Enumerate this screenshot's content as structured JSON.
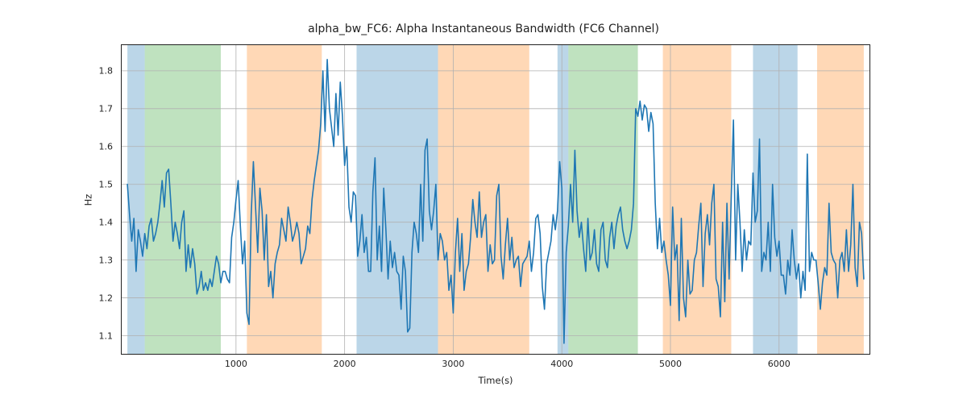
{
  "chart_data": {
    "type": "line",
    "title": "alpha_bw_FC6: Alpha Instantaneous Bandwidth (FC6 Channel)",
    "xlabel": "Time(s)",
    "ylabel": "Hz",
    "xlim": [
      -60,
      6840
    ],
    "ylim": [
      1.05,
      1.87
    ],
    "xticks": [
      1000,
      2000,
      3000,
      4000,
      5000,
      6000
    ],
    "yticks": [
      1.1,
      1.2,
      1.3,
      1.4,
      1.5,
      1.6,
      1.7,
      1.8
    ],
    "regions": [
      {
        "x0": 0,
        "x1": 160,
        "color": "#1f77b4"
      },
      {
        "x0": 160,
        "x1": 860,
        "color": "#2ca02c"
      },
      {
        "x0": 1100,
        "x1": 1790,
        "color": "#ff7f0e"
      },
      {
        "x0": 2110,
        "x1": 2860,
        "color": "#1f77b4"
      },
      {
        "x0": 2860,
        "x1": 3700,
        "color": "#ff7f0e"
      },
      {
        "x0": 3960,
        "x1": 4060,
        "color": "#1f77b4"
      },
      {
        "x0": 4060,
        "x1": 4700,
        "color": "#2ca02c"
      },
      {
        "x0": 4930,
        "x1": 5560,
        "color": "#ff7f0e"
      },
      {
        "x0": 5760,
        "x1": 6170,
        "color": "#1f77b4"
      },
      {
        "x0": 6350,
        "x1": 6780,
        "color": "#ff7f0e"
      }
    ],
    "series": [
      {
        "name": "alpha_bw_FC6",
        "color": "#1f77b4",
        "x": [
          0,
          20,
          40,
          60,
          80,
          100,
          120,
          140,
          160,
          180,
          200,
          220,
          240,
          260,
          280,
          300,
          320,
          340,
          360,
          380,
          400,
          420,
          440,
          460,
          480,
          500,
          520,
          540,
          560,
          580,
          600,
          620,
          640,
          660,
          680,
          700,
          720,
          740,
          760,
          780,
          800,
          820,
          840,
          860,
          880,
          900,
          920,
          940,
          960,
          980,
          1000,
          1020,
          1040,
          1060,
          1080,
          1100,
          1120,
          1140,
          1160,
          1180,
          1200,
          1220,
          1240,
          1260,
          1280,
          1300,
          1320,
          1340,
          1360,
          1380,
          1400,
          1420,
          1440,
          1460,
          1480,
          1500,
          1520,
          1540,
          1560,
          1580,
          1600,
          1620,
          1640,
          1660,
          1680,
          1700,
          1720,
          1740,
          1760,
          1780,
          1800,
          1820,
          1840,
          1860,
          1880,
          1900,
          1920,
          1940,
          1960,
          1980,
          2000,
          2020,
          2040,
          2060,
          2080,
          2100,
          2120,
          2140,
          2160,
          2180,
          2200,
          2220,
          2240,
          2260,
          2280,
          2300,
          2320,
          2340,
          2360,
          2380,
          2400,
          2420,
          2440,
          2460,
          2480,
          2500,
          2520,
          2540,
          2560,
          2580,
          2600,
          2620,
          2640,
          2660,
          2680,
          2700,
          2720,
          2740,
          2760,
          2780,
          2800,
          2820,
          2840,
          2860,
          2880,
          2900,
          2920,
          2940,
          2960,
          2980,
          3000,
          3020,
          3040,
          3060,
          3080,
          3100,
          3120,
          3140,
          3160,
          3180,
          3200,
          3220,
          3240,
          3260,
          3280,
          3300,
          3320,
          3340,
          3360,
          3380,
          3400,
          3420,
          3440,
          3460,
          3480,
          3500,
          3520,
          3540,
          3560,
          3580,
          3600,
          3620,
          3640,
          3660,
          3680,
          3700,
          3720,
          3740,
          3760,
          3780,
          3800,
          3820,
          3840,
          3860,
          3880,
          3900,
          3920,
          3940,
          3960,
          3980,
          4000,
          4020,
          4040,
          4060,
          4080,
          4100,
          4120,
          4140,
          4160,
          4180,
          4200,
          4220,
          4240,
          4260,
          4280,
          4300,
          4320,
          4340,
          4360,
          4380,
          4400,
          4420,
          4440,
          4460,
          4480,
          4500,
          4520,
          4540,
          4560,
          4580,
          4600,
          4620,
          4640,
          4660,
          4680,
          4700,
          4720,
          4740,
          4760,
          4780,
          4800,
          4820,
          4840,
          4860,
          4880,
          4900,
          4920,
          4940,
          4960,
          4980,
          5000,
          5020,
          5040,
          5060,
          5080,
          5100,
          5120,
          5140,
          5160,
          5180,
          5200,
          5220,
          5240,
          5260,
          5280,
          5300,
          5320,
          5340,
          5360,
          5380,
          5400,
          5420,
          5440,
          5460,
          5480,
          5500,
          5520,
          5540,
          5560,
          5580,
          5600,
          5620,
          5640,
          5660,
          5680,
          5700,
          5720,
          5740,
          5760,
          5780,
          5800,
          5820,
          5840,
          5860,
          5880,
          5900,
          5920,
          5940,
          5960,
          5980,
          6000,
          6020,
          6040,
          6060,
          6080,
          6100,
          6120,
          6140,
          6160,
          6180,
          6200,
          6220,
          6240,
          6260,
          6280,
          6300,
          6320,
          6340,
          6360,
          6380,
          6400,
          6420,
          6440,
          6460,
          6480,
          6500,
          6520,
          6540,
          6560,
          6580,
          6600,
          6620,
          6640,
          6660,
          6680,
          6700,
          6720,
          6740,
          6760,
          6780
        ],
        "values": [
          1.5,
          1.42,
          1.35,
          1.41,
          1.27,
          1.38,
          1.35,
          1.31,
          1.37,
          1.33,
          1.39,
          1.41,
          1.35,
          1.37,
          1.4,
          1.45,
          1.51,
          1.44,
          1.53,
          1.54,
          1.45,
          1.35,
          1.4,
          1.37,
          1.33,
          1.4,
          1.43,
          1.27,
          1.34,
          1.28,
          1.33,
          1.29,
          1.21,
          1.23,
          1.27,
          1.22,
          1.24,
          1.22,
          1.25,
          1.23,
          1.27,
          1.31,
          1.29,
          1.24,
          1.27,
          1.27,
          1.25,
          1.24,
          1.36,
          1.4,
          1.46,
          1.51,
          1.39,
          1.29,
          1.35,
          1.16,
          1.13,
          1.42,
          1.56,
          1.44,
          1.32,
          1.49,
          1.43,
          1.3,
          1.42,
          1.23,
          1.27,
          1.2,
          1.29,
          1.32,
          1.34,
          1.41,
          1.38,
          1.35,
          1.44,
          1.4,
          1.35,
          1.37,
          1.4,
          1.37,
          1.29,
          1.31,
          1.33,
          1.39,
          1.37,
          1.46,
          1.51,
          1.55,
          1.59,
          1.66,
          1.8,
          1.64,
          1.83,
          1.7,
          1.65,
          1.6,
          1.74,
          1.63,
          1.77,
          1.68,
          1.55,
          1.6,
          1.44,
          1.4,
          1.48,
          1.47,
          1.31,
          1.35,
          1.42,
          1.32,
          1.36,
          1.27,
          1.27,
          1.48,
          1.57,
          1.3,
          1.39,
          1.27,
          1.49,
          1.38,
          1.25,
          1.35,
          1.28,
          1.32,
          1.27,
          1.26,
          1.17,
          1.31,
          1.27,
          1.11,
          1.12,
          1.32,
          1.4,
          1.37,
          1.32,
          1.5,
          1.35,
          1.59,
          1.62,
          1.43,
          1.38,
          1.43,
          1.5,
          1.3,
          1.37,
          1.35,
          1.3,
          1.32,
          1.22,
          1.26,
          1.16,
          1.32,
          1.41,
          1.27,
          1.37,
          1.22,
          1.27,
          1.29,
          1.36,
          1.46,
          1.4,
          1.36,
          1.48,
          1.36,
          1.4,
          1.42,
          1.27,
          1.34,
          1.29,
          1.3,
          1.47,
          1.5,
          1.31,
          1.25,
          1.34,
          1.41,
          1.3,
          1.36,
          1.28,
          1.3,
          1.31,
          1.23,
          1.29,
          1.3,
          1.31,
          1.35,
          1.27,
          1.32,
          1.41,
          1.42,
          1.37,
          1.23,
          1.17,
          1.29,
          1.32,
          1.35,
          1.42,
          1.38,
          1.43,
          1.56,
          1.49,
          1.08,
          1.32,
          1.39,
          1.5,
          1.4,
          1.59,
          1.43,
          1.36,
          1.4,
          1.33,
          1.27,
          1.41,
          1.3,
          1.32,
          1.38,
          1.29,
          1.27,
          1.38,
          1.4,
          1.3,
          1.28,
          1.36,
          1.4,
          1.33,
          1.39,
          1.42,
          1.44,
          1.38,
          1.35,
          1.33,
          1.35,
          1.38,
          1.45,
          1.7,
          1.68,
          1.72,
          1.67,
          1.71,
          1.7,
          1.64,
          1.69,
          1.66,
          1.45,
          1.33,
          1.41,
          1.32,
          1.35,
          1.3,
          1.26,
          1.18,
          1.44,
          1.3,
          1.34,
          1.14,
          1.41,
          1.2,
          1.15,
          1.3,
          1.21,
          1.22,
          1.3,
          1.32,
          1.39,
          1.45,
          1.23,
          1.37,
          1.42,
          1.34,
          1.45,
          1.5,
          1.25,
          1.23,
          1.15,
          1.4,
          1.19,
          1.45,
          1.25,
          1.47,
          1.67,
          1.3,
          1.5,
          1.4,
          1.27,
          1.38,
          1.3,
          1.35,
          1.34,
          1.53,
          1.4,
          1.43,
          1.62,
          1.27,
          1.32,
          1.3,
          1.4,
          1.27,
          1.5,
          1.36,
          1.31,
          1.35,
          1.26,
          1.26,
          1.21,
          1.3,
          1.26,
          1.38,
          1.3,
          1.25,
          1.29,
          1.2,
          1.27,
          1.22,
          1.58,
          1.27,
          1.32,
          1.3,
          1.3,
          1.24,
          1.17,
          1.24,
          1.28,
          1.26,
          1.45,
          1.32,
          1.3,
          1.29,
          1.2,
          1.3,
          1.32,
          1.27,
          1.38,
          1.27,
          1.34,
          1.5,
          1.28,
          1.23,
          1.4,
          1.37,
          1.25
        ]
      }
    ]
  }
}
